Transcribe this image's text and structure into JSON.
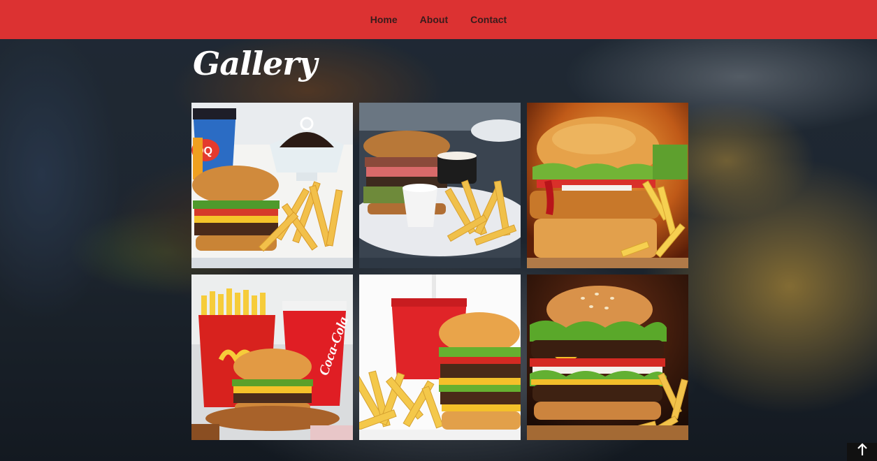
{
  "nav": {
    "items": [
      {
        "label": "Home"
      },
      {
        "label": "About"
      },
      {
        "label": "Contact"
      }
    ]
  },
  "gallery": {
    "title": "Gallery",
    "items": [
      {
        "icon": "dq-combo-image"
      },
      {
        "icon": "burger-plate-image"
      },
      {
        "icon": "chicken-burger-image"
      },
      {
        "icon": "mcdonalds-combo-image"
      },
      {
        "icon": "burger-fries-soda-image"
      },
      {
        "icon": "double-cheeseburger-image"
      }
    ]
  },
  "colors": {
    "navbar": "#dc3232",
    "nav_text": "#3a1c1c",
    "title": "#ffffff"
  },
  "back_to_top": {
    "icon": "arrow-up-icon"
  }
}
